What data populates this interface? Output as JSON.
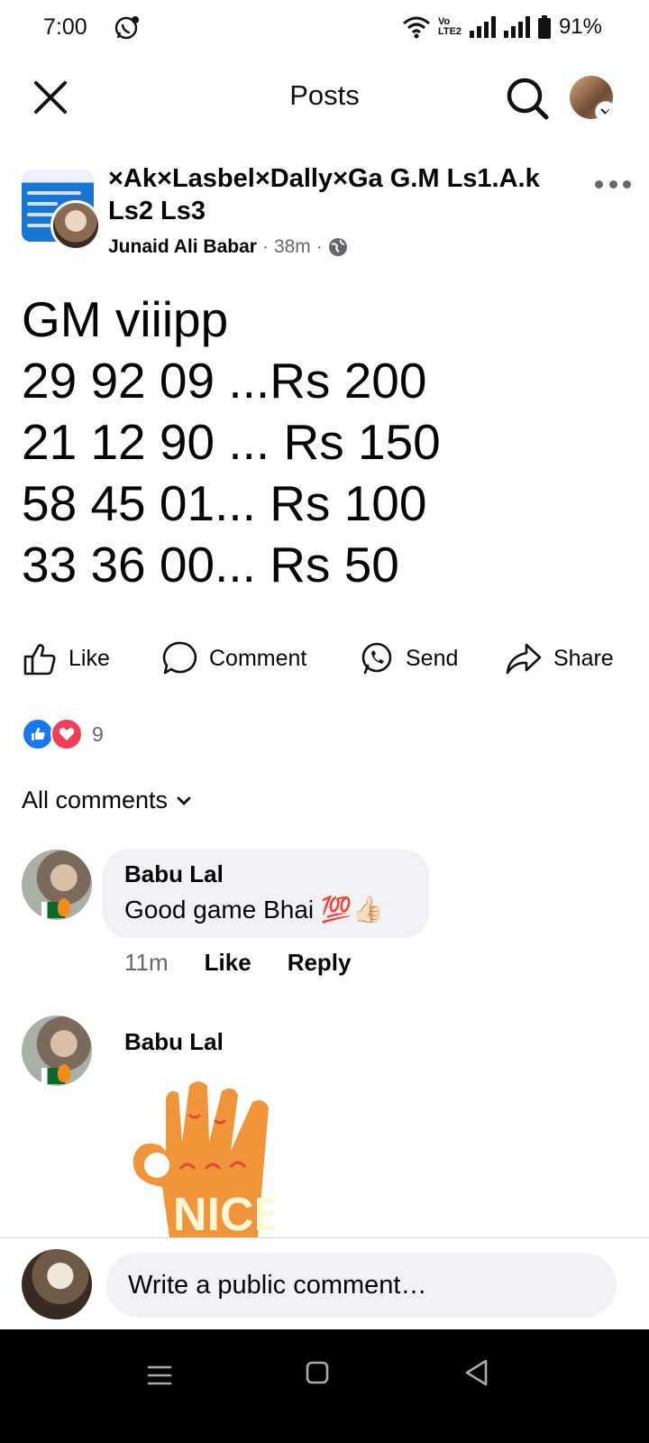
{
  "status_bar": {
    "time": "7:00",
    "network": "Vo LTE2",
    "battery": "91%"
  },
  "nav": {
    "title": "Posts"
  },
  "post": {
    "group_name": "×Ak×Lasbel×Dally×Ga G.M Ls1.A.k Ls2 Ls3",
    "author": "Junaid Ali Babar",
    "time": "38m",
    "separator": "·",
    "body_lines": [
      "GM viiipp",
      "29 92 09 ...Rs 200",
      "21 12 90 ... Rs 150",
      "58 45 01... Rs 100",
      "33 36 00... Rs 50"
    ]
  },
  "actions": {
    "like": "Like",
    "comment": "Comment",
    "send": "Send",
    "share": "Share"
  },
  "reactions": {
    "count": "9"
  },
  "comments_filter": "All comments",
  "comments": [
    {
      "name": "Babu Lal",
      "text": "Good game Bhai 💯👍🏻",
      "time": "11m",
      "like": "Like",
      "reply": "Reply"
    },
    {
      "name": "Babu Lal",
      "sticker_text": "NICE"
    }
  ],
  "composer": {
    "placeholder": "Write a public comment…"
  },
  "colors": {
    "accent": "#1877f2",
    "love": "#f33e58",
    "secondary_text": "#65676b",
    "bubble": "#f0f2f5"
  }
}
